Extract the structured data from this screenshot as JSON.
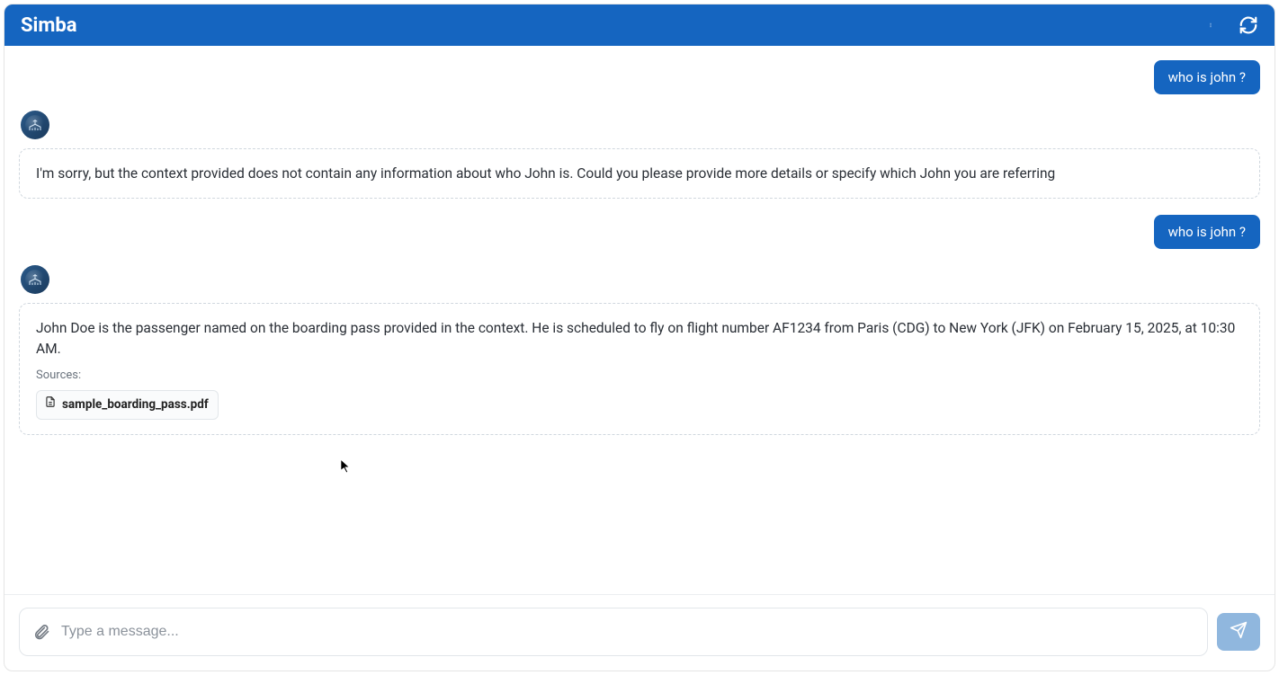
{
  "header": {
    "title": "Simba"
  },
  "messages": {
    "user1": "who is john ?",
    "bot1_text": "I'm sorry, but the context provided does not contain any information about who John is. Could you please provide more details or specify which John you are referring",
    "user2": "who is john ?",
    "bot2_text": "John Doe is the passenger named on the boarding pass provided in the context. He is scheduled to fly on flight number AF1234 from Paris (CDG) to New York (JFK) on February 15, 2025, at 10:30 AM.",
    "bot2_sources_label": "Sources:",
    "bot2_source1_name": "sample_boarding_pass.pdf"
  },
  "input": {
    "placeholder": "Type a message...",
    "value": ""
  }
}
